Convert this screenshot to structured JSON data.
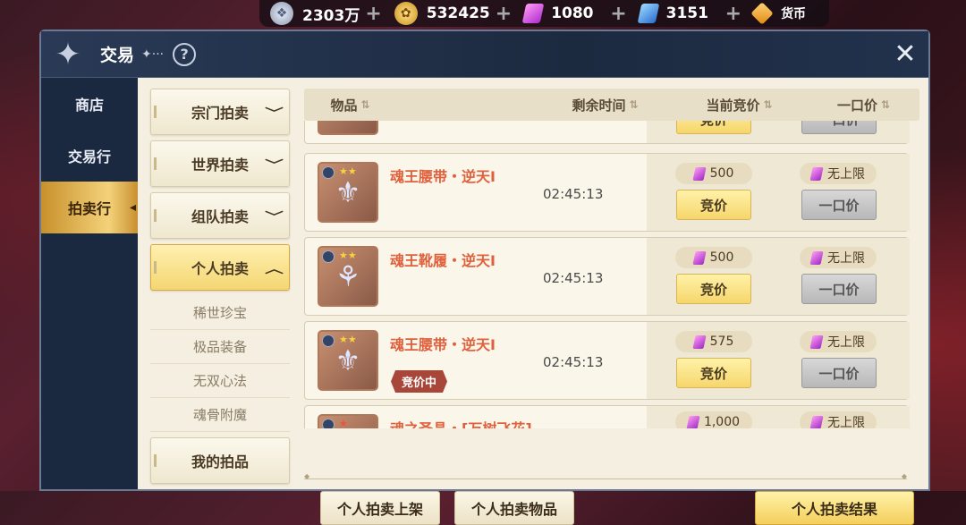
{
  "currency": [
    {
      "icon": "silver-coin-icon",
      "value": "2303万",
      "plus": "+"
    },
    {
      "icon": "gold-coin-icon",
      "value": "532425",
      "plus": "+"
    },
    {
      "icon": "purple-crystal-icon",
      "value": "1080",
      "plus": "+"
    },
    {
      "icon": "blue-crystal-icon",
      "value": "3151",
      "plus": "+"
    }
  ],
  "currency_label": "货币",
  "window": {
    "title": "交易",
    "title_deco": "✦···",
    "help": "?",
    "close": "✕"
  },
  "leftnav": [
    {
      "label": "商店"
    },
    {
      "label": "交易行"
    },
    {
      "label": "拍卖行"
    }
  ],
  "categories": [
    {
      "label": "宗门拍卖",
      "chev": "﹀"
    },
    {
      "label": "世界拍卖",
      "chev": "﹀"
    },
    {
      "label": "组队拍卖",
      "chev": "﹀"
    },
    {
      "label": "个人拍卖",
      "chev": "︿"
    }
  ],
  "subcategories": [
    {
      "label": "稀世珍宝"
    },
    {
      "label": "极品装备"
    },
    {
      "label": "无双心法"
    },
    {
      "label": "魂骨附魔"
    }
  ],
  "my_items": "我的拍品",
  "table": {
    "headers": [
      {
        "label": "物品"
      },
      {
        "label": "剩余时间"
      },
      {
        "label": "当前竞价"
      },
      {
        "label": "一口价"
      }
    ],
    "bid_label": "竞价",
    "buyout_label": "一口价",
    "rows": [
      {
        "name": "",
        "time": "",
        "bid_price": "",
        "buyout": "",
        "tag": ""
      },
      {
        "name": "魂王腰带・逆天I",
        "time": "02:45:13",
        "bid_price": "500",
        "buyout": "无上限",
        "tag": ""
      },
      {
        "name": "魂王靴履・逆天I",
        "time": "02:45:13",
        "bid_price": "500",
        "buyout": "无上限",
        "tag": ""
      },
      {
        "name": "魂王腰带・逆天I",
        "time": "02:45:13",
        "bid_price": "575",
        "buyout": "无上限",
        "tag": "竞价中"
      },
      {
        "name": "魂之圣晶・[万树飞花]",
        "time": "",
        "bid_price": "1,000",
        "buyout": "无上限",
        "tag": ""
      }
    ]
  },
  "bottom": {
    "list_btn": "个人拍卖上架",
    "items_btn": "个人拍卖物品",
    "result_btn": "个人拍卖结果"
  },
  "colors": {
    "accent": "#f4d27a",
    "item_name": "#e0603c",
    "window_bg": "#1c2a40",
    "panel_bg": "#f4efe0"
  }
}
